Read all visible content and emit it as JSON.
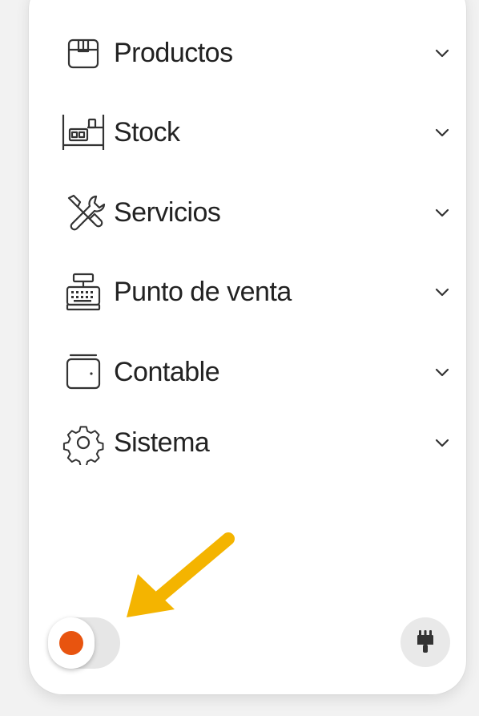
{
  "menu": {
    "items": [
      {
        "id": "productos",
        "label": "Productos",
        "icon": "box-icon"
      },
      {
        "id": "stock",
        "label": "Stock",
        "icon": "shelf-icon"
      },
      {
        "id": "servicios",
        "label": "Servicios",
        "icon": "tools-icon"
      },
      {
        "id": "punto_de_venta",
        "label": "Punto de venta",
        "icon": "cash-register-icon"
      },
      {
        "id": "contable",
        "label": "Contable",
        "icon": "wallet-icon"
      },
      {
        "id": "sistema",
        "label": "Sistema",
        "icon": "gear-icon"
      }
    ]
  },
  "footer": {
    "theme_toggle": {
      "state": "off",
      "dot_color": "#e8540f"
    },
    "brush_icon": "paint-brush-icon"
  },
  "colors": {
    "text": "#222222",
    "icon_stroke": "#333333",
    "arrow": "#f4b400",
    "panel_bg": "#ffffff",
    "page_bg": "#f2f2f2"
  }
}
